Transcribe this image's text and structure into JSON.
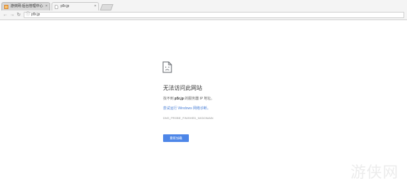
{
  "browser": {
    "tabs": [
      {
        "label": "游侠网-后台管理中心",
        "favicon": "site-favicon",
        "close": "×"
      },
      {
        "label": "p5r.jp",
        "favicon": "page-favicon",
        "close": "×"
      }
    ],
    "nav": {
      "back": "←",
      "forward": "→",
      "reload": "↻"
    },
    "address": {
      "info_icon": "ⓘ",
      "url": "p5r.jp"
    }
  },
  "error": {
    "icon": "sad-page-icon",
    "title": "无法访问此网站",
    "desc_prefix": "找不到",
    "desc_host": "p5r.jp",
    "desc_suffix": "的服务器 IP 地址。",
    "link": "尝试运行 Windows 网络诊断。",
    "code": "DNS_PROBE_FINISHED_NXDOMAIN",
    "button": "重新加载"
  },
  "watermark": {
    "text": "游侠网",
    "logo": "ali213-logo"
  },
  "colors": {
    "accent": "#4d86e8",
    "link": "#4a7fd6"
  }
}
